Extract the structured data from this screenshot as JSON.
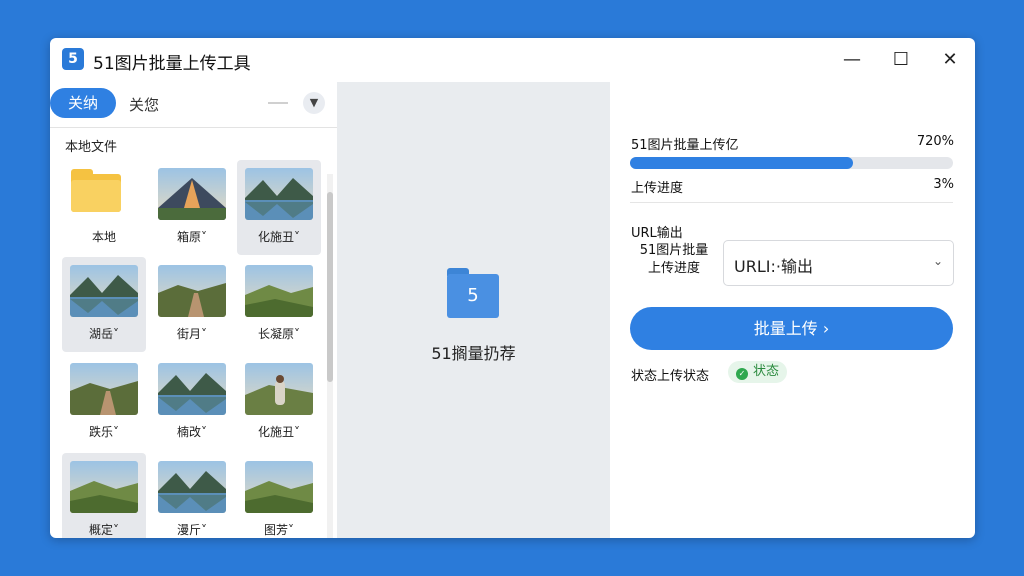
{
  "window": {
    "app_icon": "5",
    "title": "51图片批量上传工具",
    "controls": {
      "minimize": "—",
      "maximize": "☐",
      "close": "✕"
    }
  },
  "left": {
    "tabs": [
      {
        "label": "关纳",
        "active": true
      },
      {
        "label": "关您",
        "active": false
      }
    ],
    "section_label": "本地文件",
    "items": [
      {
        "label": "本地",
        "type": "folder",
        "selected": false
      },
      {
        "label": "箱原˅",
        "type": "image",
        "scene": "peak",
        "selected": false
      },
      {
        "label": "化施丑˅",
        "type": "image",
        "scene": "lake",
        "selected": true
      },
      {
        "label": "湖岳˅",
        "type": "image",
        "scene": "lake",
        "selected": true
      },
      {
        "label": "街月˅",
        "type": "image",
        "scene": "road",
        "selected": false
      },
      {
        "label": "长凝原˅",
        "type": "image",
        "scene": "hills",
        "selected": false
      },
      {
        "label": "跌乐˅",
        "type": "image",
        "scene": "road",
        "selected": false
      },
      {
        "label": "楠改˅",
        "type": "image",
        "scene": "lake",
        "selected": false
      },
      {
        "label": "化施丑˅",
        "type": "image",
        "scene": "person",
        "selected": false
      },
      {
        "label": "概定˅",
        "type": "image",
        "scene": "hills",
        "selected": true
      },
      {
        "label": "漫斤˅",
        "type": "image",
        "scene": "lake",
        "selected": false
      },
      {
        "label": "图芳˅",
        "type": "image",
        "scene": "hills",
        "selected": false
      }
    ]
  },
  "middle": {
    "folder_glyph": "5",
    "label": "51搁量扔荐"
  },
  "right": {
    "upload_label": "51图片批量上传亿",
    "upload_percent": "720%",
    "progress_fraction": 0.69,
    "progress_label": "上传进度",
    "progress_percent": "3%",
    "url_label": "URL输出",
    "side_label_line1": "51图片批量",
    "side_label_line2": "上传进度",
    "url_select_value": "URLI:·输出",
    "batch_button": "批量上传 ›",
    "status_label": "状态上传状态",
    "status_badge": "状态"
  },
  "colors": {
    "background": "#2a7ad8",
    "accent": "#2f80e2",
    "status_green": "#2fa84f"
  }
}
